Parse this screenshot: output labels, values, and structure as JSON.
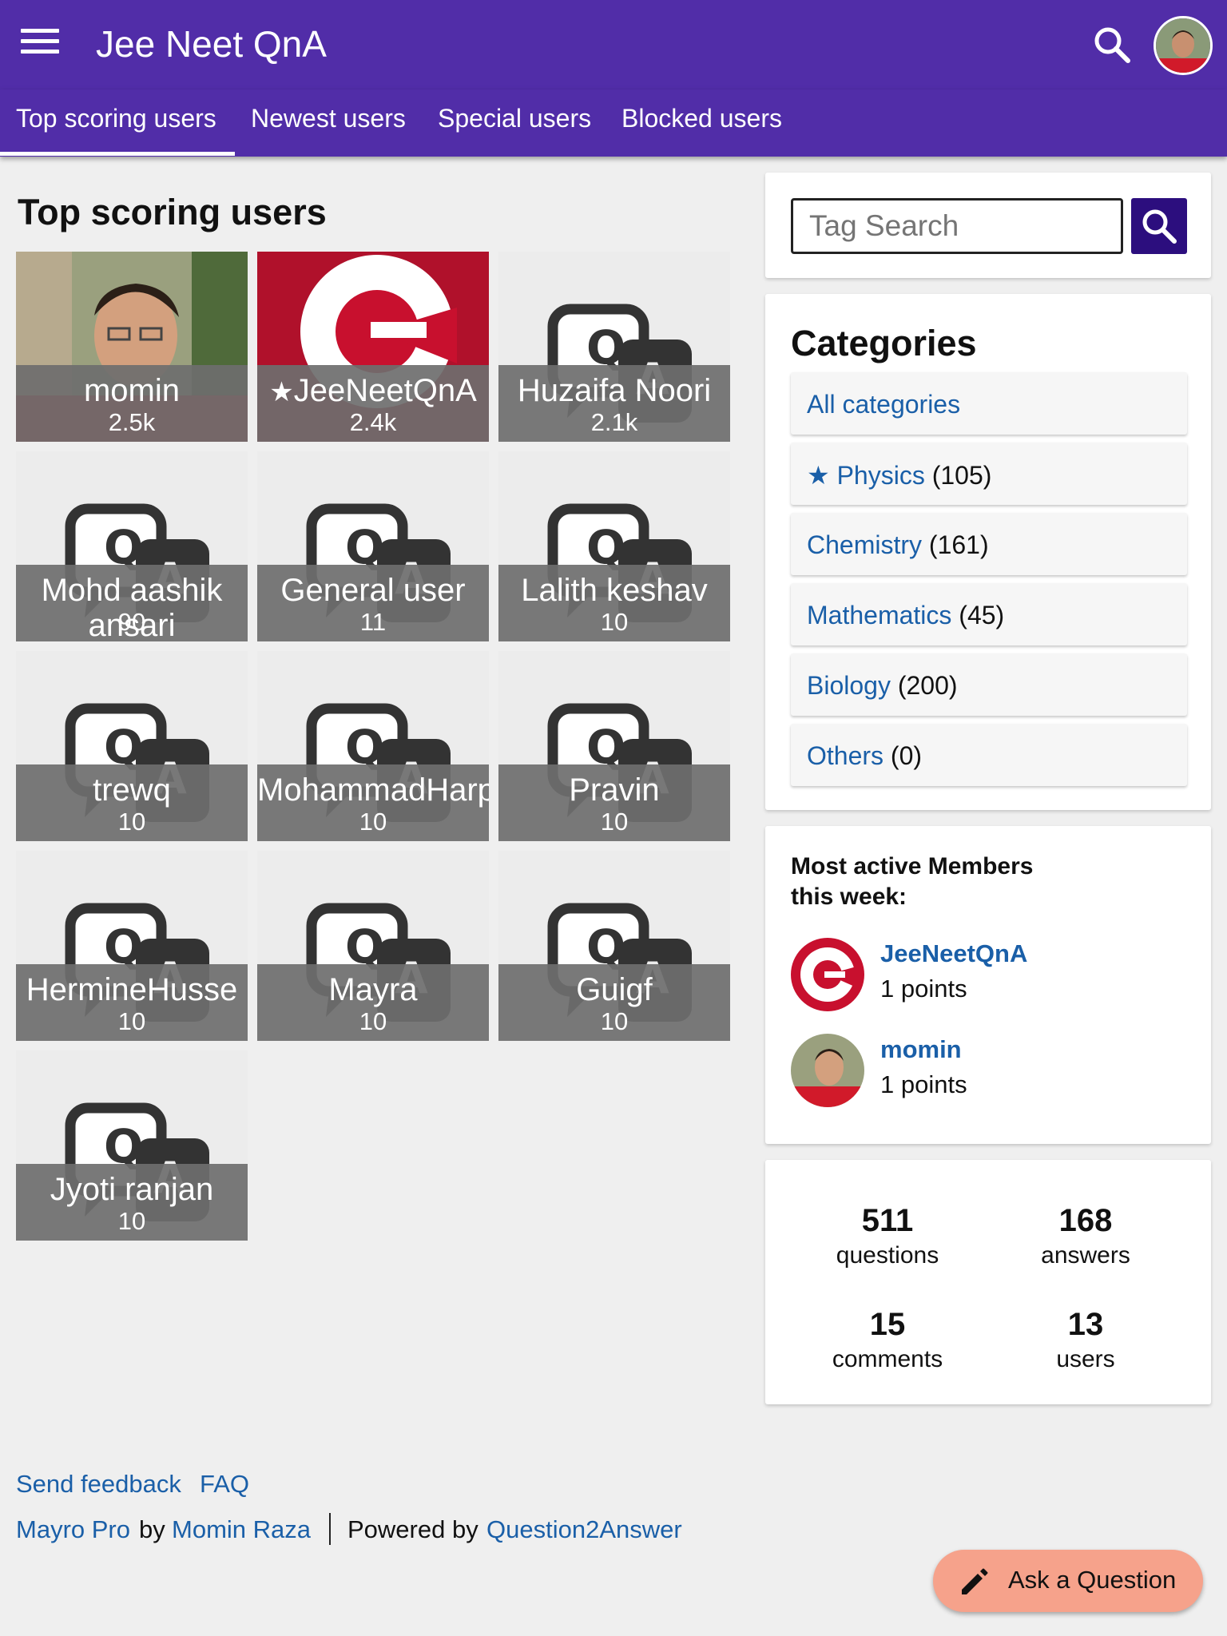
{
  "header": {
    "site_title": "Jee Neet QnA",
    "menu_icon": "hamburger-menu-icon",
    "search_icon": "search-icon",
    "avatar": "user-avatar",
    "brand_color": "#512da8"
  },
  "tabs": [
    {
      "label": "Top scoring users",
      "active": true
    },
    {
      "label": "Newest users",
      "active": false
    },
    {
      "label": "Special users",
      "active": false
    },
    {
      "label": "Blocked users",
      "active": false
    }
  ],
  "main": {
    "heading": "Top scoring users",
    "users": [
      {
        "name": "momin",
        "points": "2.5k",
        "photo": "person-photo"
      },
      {
        "name": "JeeNeetQnA",
        "points": "2.4k",
        "special_icon": "star-icon",
        "photo": "brand-logo"
      },
      {
        "name": "Huzaifa Noori",
        "points": "2.1k",
        "photo": "default-qa-avatar"
      },
      {
        "name": "Mohd aashik ansari",
        "points": "90",
        "photo": "default-qa-avatar"
      },
      {
        "name": "General user",
        "points": "11",
        "photo": "default-qa-avatar"
      },
      {
        "name": "Lalith keshav",
        "points": "10",
        "photo": "default-qa-avatar"
      },
      {
        "name": "trewq",
        "points": "10",
        "photo": "default-qa-avatar"
      },
      {
        "name": "MohammadHarp",
        "points": "10",
        "photo": "default-qa-avatar"
      },
      {
        "name": "Pravin",
        "points": "10",
        "photo": "default-qa-avatar"
      },
      {
        "name": "HermineHusse",
        "points": "10",
        "photo": "default-qa-avatar"
      },
      {
        "name": "Mayra",
        "points": "10",
        "photo": "default-qa-avatar"
      },
      {
        "name": "Guigf",
        "points": "10",
        "photo": "default-qa-avatar"
      },
      {
        "name": "Jyoti ranjan",
        "points": "10",
        "photo": "default-qa-avatar"
      }
    ]
  },
  "sidebar": {
    "tag_search": {
      "placeholder": "Tag Search",
      "button_icon": "search-icon"
    },
    "categories": {
      "heading": "Categories",
      "items": [
        {
          "name": "All categories",
          "count": ""
        },
        {
          "name": "Physics",
          "count": "(105)",
          "icon": "star-icon"
        },
        {
          "name": "Chemistry",
          "count": "(161)"
        },
        {
          "name": "Mathematics",
          "count": "(45)"
        },
        {
          "name": "Biology",
          "count": "(200)"
        },
        {
          "name": "Others",
          "count": "(0)"
        }
      ]
    },
    "active_members": {
      "heading": "Most active Members this week:",
      "members": [
        {
          "name": "JeeNeetQnA",
          "points": "1 points"
        },
        {
          "name": "momin",
          "points": "1 points"
        }
      ]
    },
    "stats": [
      {
        "value": "511",
        "label": "questions"
      },
      {
        "value": "168",
        "label": "answers"
      },
      {
        "value": "15",
        "label": "comments"
      },
      {
        "value": "13",
        "label": "users"
      }
    ]
  },
  "footer": {
    "feedback": "Send feedback",
    "faq": "FAQ",
    "theme": "Mayro Pro",
    "by": "by",
    "author": "Momin Raza",
    "powered_by": "Powered by",
    "engine": "Question2Answer"
  },
  "fab": {
    "label": "Ask a Question",
    "icon": "pencil-icon",
    "color": "#f6a28b"
  }
}
